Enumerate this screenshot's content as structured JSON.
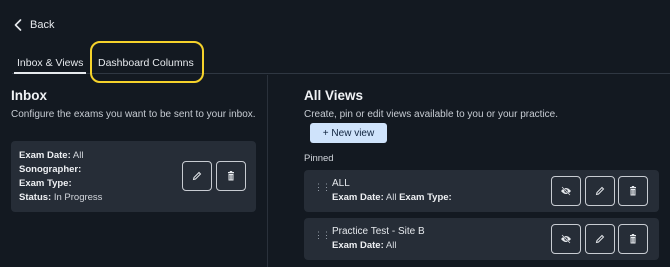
{
  "nav": {
    "back_label": "Back"
  },
  "tabs": [
    {
      "label": "Inbox & Views",
      "active": true
    },
    {
      "label": "Dashboard Columns",
      "active": false
    }
  ],
  "inbox": {
    "title": "Inbox",
    "description": "Configure the exams you want to be sent to your inbox.",
    "filters": [
      {
        "label": "Exam Date:",
        "value": "All"
      },
      {
        "label": "Sonographer:",
        "value": ""
      },
      {
        "label": "Exam Type:",
        "value": ""
      },
      {
        "label": "Status:",
        "value": "In Progress"
      }
    ]
  },
  "views": {
    "title": "All Views",
    "description": "Create, pin or edit views available to you or your practice.",
    "new_view_label": "+ New view",
    "pinned_label": "Pinned",
    "pinned": [
      {
        "name": "ALL",
        "f1_label": "Exam Date:",
        "f1_value": "All",
        "f2_label": "Exam Type:",
        "f2_value": ""
      },
      {
        "name": "Practice Test - Site B",
        "f1_label": "Exam Date:",
        "f1_value": "All",
        "f2_label": "",
        "f2_value": ""
      }
    ]
  },
  "colors": {
    "background": "#131921",
    "card": "#262d37",
    "primary_button": "#cfe3fb",
    "highlight": "#f5d22b"
  },
  "icons": [
    "chevron-left-icon",
    "pencil-icon",
    "trash-icon",
    "eye-off-icon",
    "drag-handle-icon"
  ]
}
